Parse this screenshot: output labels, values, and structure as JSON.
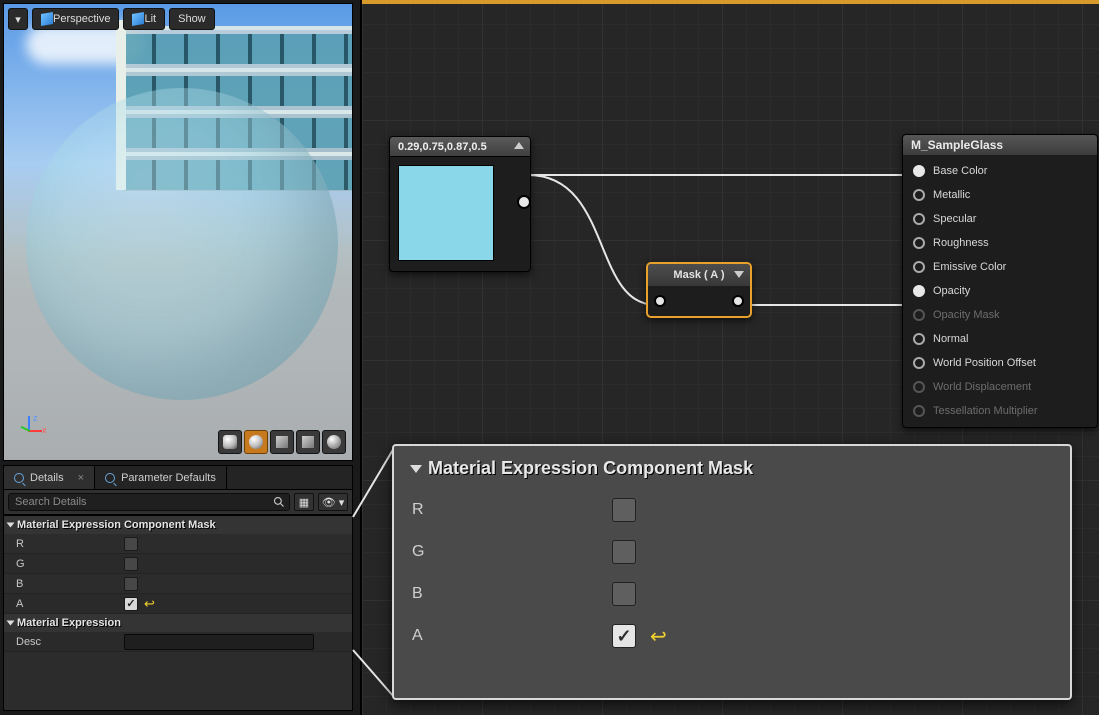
{
  "viewport": {
    "options_label": "",
    "perspective_label": "Perspective",
    "lit_label": "Lit",
    "show_label": "Show",
    "axis": {
      "x": "x",
      "y": "",
      "z": "z"
    }
  },
  "tabs": {
    "details": "Details",
    "param_defaults": "Parameter Defaults"
  },
  "search": {
    "placeholder": "Search Details"
  },
  "details": {
    "section1_title": "Material Expression Component Mask",
    "rows": {
      "r": {
        "label": "R",
        "checked": false
      },
      "g": {
        "label": "G",
        "checked": false
      },
      "b": {
        "label": "B",
        "checked": false
      },
      "a": {
        "label": "A",
        "checked": true
      }
    },
    "section2_title": "Material Expression",
    "desc_label": "Desc",
    "desc_value": ""
  },
  "nodes": {
    "constant4": {
      "title": "0.29,0.75,0.87,0.5",
      "color": "#89d7e8"
    },
    "mask": {
      "title": "Mask ( A )"
    },
    "result": {
      "title": "M_SampleGlass",
      "pins": [
        {
          "label": "Base Color",
          "connected": true,
          "enabled": true
        },
        {
          "label": "Metallic",
          "connected": false,
          "enabled": true
        },
        {
          "label": "Specular",
          "connected": false,
          "enabled": true
        },
        {
          "label": "Roughness",
          "connected": false,
          "enabled": true
        },
        {
          "label": "Emissive Color",
          "connected": false,
          "enabled": true
        },
        {
          "label": "Opacity",
          "connected": true,
          "enabled": true
        },
        {
          "label": "Opacity Mask",
          "connected": false,
          "enabled": false
        },
        {
          "label": "Normal",
          "connected": false,
          "enabled": true
        },
        {
          "label": "World Position Offset",
          "connected": false,
          "enabled": true
        },
        {
          "label": "World Displacement",
          "connected": false,
          "enabled": false
        },
        {
          "label": "Tessellation Multiplier",
          "connected": false,
          "enabled": false
        }
      ]
    }
  },
  "callout": {
    "title": "Material Expression Component Mask",
    "rows": [
      {
        "label": "R",
        "checked": false
      },
      {
        "label": "G",
        "checked": false
      },
      {
        "label": "B",
        "checked": false
      },
      {
        "label": "A",
        "checked": true
      }
    ]
  }
}
